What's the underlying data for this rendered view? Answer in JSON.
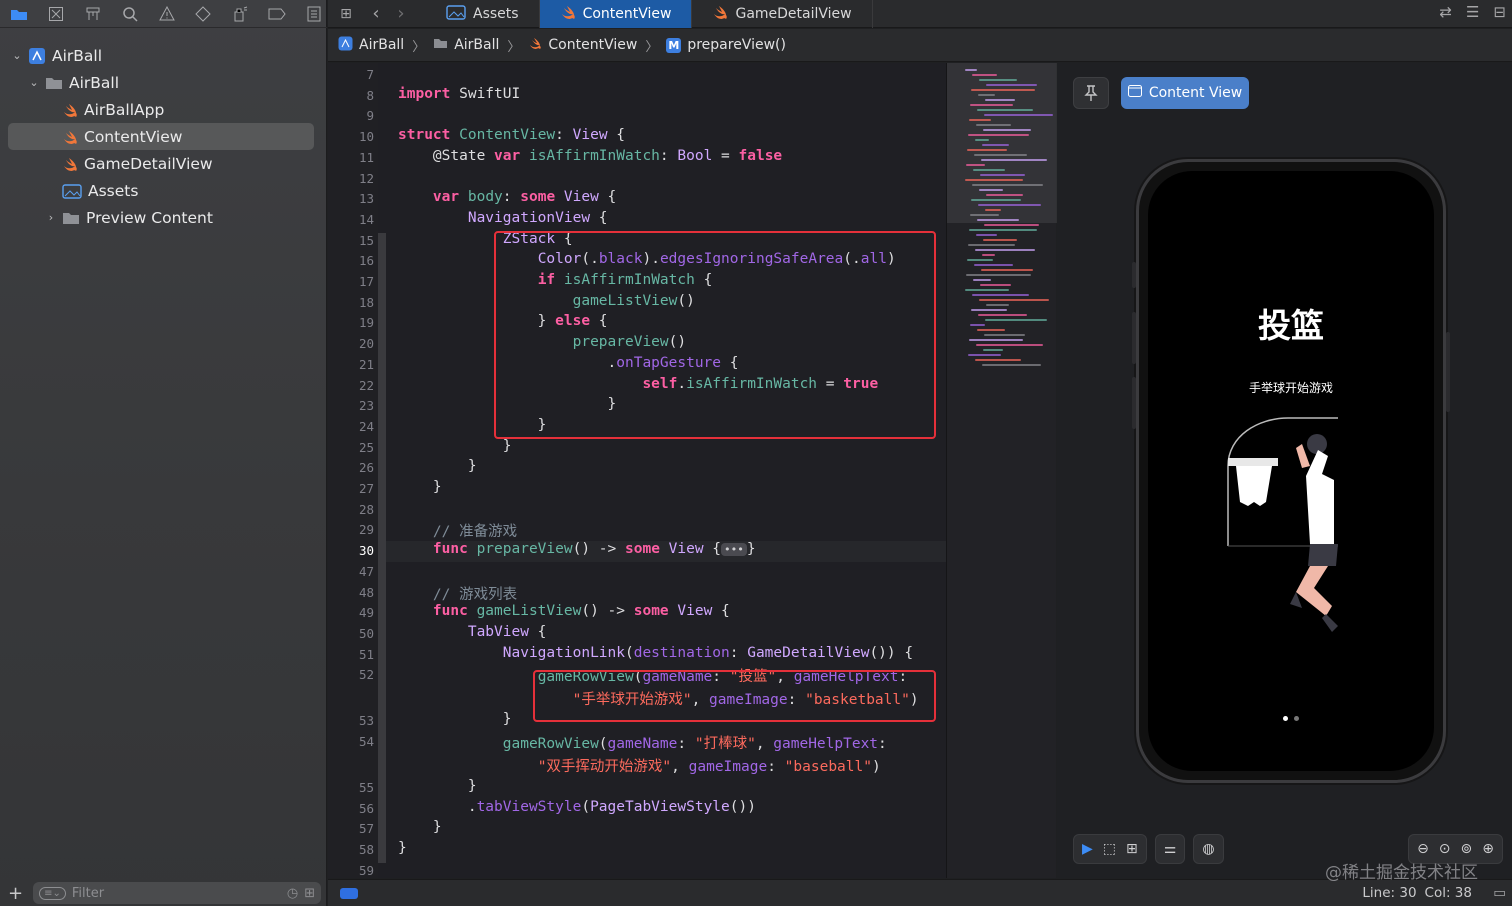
{
  "navigator": {
    "icons": [
      "folder-icon",
      "source-control-icon",
      "hierarchy-icon",
      "find-icon",
      "issue-warning-icon",
      "test-diamond-icon",
      "debug-spray-icon",
      "breakpoint-tag-icon",
      "report-icon"
    ],
    "tree": [
      {
        "label": "AirBall",
        "kind": "project",
        "indent": 0,
        "chevron": "down"
      },
      {
        "label": "AirBall",
        "kind": "folder",
        "indent": 1,
        "chevron": "down"
      },
      {
        "label": "AirBallApp",
        "kind": "swift",
        "indent": 2
      },
      {
        "label": "ContentView",
        "kind": "swift",
        "indent": 2,
        "selected": true
      },
      {
        "label": "GameDetailView",
        "kind": "swift",
        "indent": 2
      },
      {
        "label": "Assets",
        "kind": "assets",
        "indent": 2
      },
      {
        "label": "Preview Content",
        "kind": "folder",
        "indent": 2,
        "chevron": "right"
      }
    ],
    "filter_placeholder": "Filter"
  },
  "tabs": [
    {
      "label": "Assets",
      "active": false
    },
    {
      "label": "ContentView",
      "active": true
    },
    {
      "label": "GameDetailView",
      "active": false
    }
  ],
  "jumpbar": [
    "AirBall",
    "AirBall",
    "ContentView",
    "prepareView()"
  ],
  "jump_method_badge": "M",
  "code": {
    "lines": [
      {
        "n": "7",
        "t": []
      },
      {
        "n": "8",
        "t": [
          [
            "kw",
            "import"
          ],
          [
            "nm",
            " SwiftUI"
          ]
        ]
      },
      {
        "n": "9",
        "t": []
      },
      {
        "n": "10",
        "t": [
          [
            "kw",
            "struct"
          ],
          [
            "nm",
            " "
          ],
          [
            "fn",
            "ContentView"
          ],
          [
            "nm",
            ": "
          ],
          [
            "ty",
            "View"
          ],
          [
            "nm",
            " {"
          ]
        ]
      },
      {
        "n": "11",
        "t": [
          [
            "nm",
            "    @State "
          ],
          [
            "kw",
            "var"
          ],
          [
            "nm",
            " "
          ],
          [
            "fn",
            "isAffirmInWatch"
          ],
          [
            "nm",
            ": "
          ],
          [
            "ty",
            "Bool"
          ],
          [
            "nm",
            " = "
          ],
          [
            "kw",
            "false"
          ]
        ]
      },
      {
        "n": "12",
        "t": []
      },
      {
        "n": "13",
        "t": [
          [
            "nm",
            "    "
          ],
          [
            "kw",
            "var"
          ],
          [
            "nm",
            " "
          ],
          [
            "fn",
            "body"
          ],
          [
            "nm",
            ": "
          ],
          [
            "kw",
            "some"
          ],
          [
            "nm",
            " "
          ],
          [
            "ty",
            "View"
          ],
          [
            "nm",
            " {"
          ]
        ]
      },
      {
        "n": "14",
        "t": [
          [
            "nm",
            "        "
          ],
          [
            "ty",
            "NavigationView"
          ],
          [
            "nm",
            " {"
          ]
        ]
      },
      {
        "n": "15",
        "t": [
          [
            "nm",
            "            "
          ],
          [
            "ty",
            "ZStack"
          ],
          [
            "nm",
            " {"
          ]
        ]
      },
      {
        "n": "16",
        "t": [
          [
            "nm",
            "                "
          ],
          [
            "ty",
            "Color"
          ],
          [
            "nm",
            "(."
          ],
          [
            "pl",
            "black"
          ],
          [
            "nm",
            ")."
          ],
          [
            "pl",
            "edgesIgnoringSafeArea"
          ],
          [
            "nm",
            "(."
          ],
          [
            "pl",
            "all"
          ],
          [
            "nm",
            ")"
          ]
        ]
      },
      {
        "n": "17",
        "t": [
          [
            "nm",
            "                "
          ],
          [
            "kw",
            "if"
          ],
          [
            "nm",
            " "
          ],
          [
            "fn",
            "isAffirmInWatch"
          ],
          [
            "nm",
            " {"
          ]
        ]
      },
      {
        "n": "18",
        "t": [
          [
            "nm",
            "                    "
          ],
          [
            "fn",
            "gameListView"
          ],
          [
            "nm",
            "()"
          ]
        ]
      },
      {
        "n": "19",
        "t": [
          [
            "nm",
            "                } "
          ],
          [
            "kw",
            "else"
          ],
          [
            "nm",
            " {"
          ]
        ]
      },
      {
        "n": "20",
        "t": [
          [
            "nm",
            "                    "
          ],
          [
            "fn",
            "prepareView"
          ],
          [
            "nm",
            "()"
          ]
        ]
      },
      {
        "n": "21",
        "t": [
          [
            "nm",
            "                        ."
          ],
          [
            "pl",
            "onTapGesture"
          ],
          [
            "nm",
            " {"
          ]
        ]
      },
      {
        "n": "22",
        "t": [
          [
            "nm",
            "                            "
          ],
          [
            "kw",
            "self"
          ],
          [
            "nm",
            "."
          ],
          [
            "fn",
            "isAffirmInWatch"
          ],
          [
            "nm",
            " = "
          ],
          [
            "kw",
            "true"
          ]
        ]
      },
      {
        "n": "23",
        "t": [
          [
            "nm",
            "                        }"
          ]
        ]
      },
      {
        "n": "24",
        "t": [
          [
            "nm",
            "                }"
          ]
        ]
      },
      {
        "n": "25",
        "t": [
          [
            "nm",
            "            }"
          ]
        ]
      },
      {
        "n": "26",
        "t": [
          [
            "nm",
            "        }"
          ]
        ]
      },
      {
        "n": "27",
        "t": [
          [
            "nm",
            "    }"
          ]
        ]
      },
      {
        "n": "28",
        "t": []
      },
      {
        "n": "29",
        "t": [
          [
            "cm",
            "    // 准备游戏"
          ]
        ]
      },
      {
        "n": "30",
        "t": [
          [
            "nm",
            "    "
          ],
          [
            "kw",
            "func"
          ],
          [
            "nm",
            " "
          ],
          [
            "fn",
            "prepareView"
          ],
          [
            "nm",
            "() -> "
          ],
          [
            "kw",
            "some"
          ],
          [
            "nm",
            " "
          ],
          [
            "ty",
            "View"
          ],
          [
            "nm",
            " {"
          ],
          [
            "fold",
            "•••"
          ],
          [
            "nm",
            "}"
          ]
        ],
        "current": true
      },
      {
        "n": "47",
        "t": []
      },
      {
        "n": "48",
        "t": [
          [
            "cm",
            "    // 游戏列表"
          ]
        ]
      },
      {
        "n": "49",
        "t": [
          [
            "nm",
            "    "
          ],
          [
            "kw",
            "func"
          ],
          [
            "nm",
            " "
          ],
          [
            "fn",
            "gameListView"
          ],
          [
            "nm",
            "() -> "
          ],
          [
            "kw",
            "some"
          ],
          [
            "nm",
            " "
          ],
          [
            "ty",
            "View"
          ],
          [
            "nm",
            " {"
          ]
        ]
      },
      {
        "n": "50",
        "t": [
          [
            "nm",
            "        "
          ],
          [
            "ty",
            "TabView"
          ],
          [
            "nm",
            " {"
          ]
        ]
      },
      {
        "n": "51",
        "t": [
          [
            "nm",
            "            "
          ],
          [
            "ty",
            "NavigationLink"
          ],
          [
            "nm",
            "("
          ],
          [
            "pl",
            "destination"
          ],
          [
            "nm",
            ": "
          ],
          [
            "ty",
            "GameDetailView"
          ],
          [
            "nm",
            "()) {"
          ]
        ]
      },
      {
        "n": "52",
        "t": [
          [
            "nm",
            "                "
          ],
          [
            "fn",
            "gameRowView"
          ],
          [
            "nm",
            "("
          ],
          [
            "pl",
            "gameName"
          ],
          [
            "nm",
            ": "
          ],
          [
            "st",
            "\"投篮\""
          ],
          [
            "nm",
            ", "
          ],
          [
            "pl",
            "gameHelpText"
          ],
          [
            "nm",
            ":"
          ]
        ]
      },
      {
        "n": "",
        "t": [
          [
            "nm",
            "                    "
          ],
          [
            "st",
            "\"手举球开始游戏\""
          ],
          [
            "nm",
            ", "
          ],
          [
            "pl",
            "gameImage"
          ],
          [
            "nm",
            ": "
          ],
          [
            "st",
            "\"basketball\""
          ],
          [
            "nm",
            ")"
          ]
        ]
      },
      {
        "n": "53",
        "t": [
          [
            "nm",
            "            }"
          ]
        ]
      },
      {
        "n": "54",
        "t": [
          [
            "nm",
            "            "
          ],
          [
            "fn",
            "gameRowView"
          ],
          [
            "nm",
            "("
          ],
          [
            "pl",
            "gameName"
          ],
          [
            "nm",
            ": "
          ],
          [
            "st",
            "\"打棒球\""
          ],
          [
            "nm",
            ", "
          ],
          [
            "pl",
            "gameHelpText"
          ],
          [
            "nm",
            ":"
          ]
        ]
      },
      {
        "n": "",
        "t": [
          [
            "nm",
            "                "
          ],
          [
            "st",
            "\"双手挥动开始游戏\""
          ],
          [
            "nm",
            ", "
          ],
          [
            "pl",
            "gameImage"
          ],
          [
            "nm",
            ": "
          ],
          [
            "st",
            "\"baseball\""
          ],
          [
            "nm",
            ")"
          ]
        ]
      },
      {
        "n": "55",
        "t": [
          [
            "nm",
            "        }"
          ]
        ]
      },
      {
        "n": "56",
        "t": [
          [
            "nm",
            "        ."
          ],
          [
            "pl",
            "tabViewStyle"
          ],
          [
            "nm",
            "("
          ],
          [
            "ty",
            "PageTabViewStyle"
          ],
          [
            "nm",
            "())"
          ]
        ]
      },
      {
        "n": "57",
        "t": [
          [
            "nm",
            "    }"
          ]
        ]
      },
      {
        "n": "58",
        "t": [
          [
            "nm",
            "}"
          ]
        ]
      },
      {
        "n": "59",
        "t": []
      }
    ]
  },
  "preview": {
    "content_view_label": "Content View",
    "title": "投篮",
    "subtitle": "手举球开始游戏"
  },
  "status": {
    "line_label": "Line: 30",
    "col_label": "Col: 38"
  },
  "watermark": "@稀土掘金技术社区",
  "colors": {
    "keyword": "#fc5fa3",
    "type": "#d0a8ff",
    "func": "#67b7a4",
    "param": "#a167e6",
    "string": "#fc6a5d",
    "comment": "#7f8c98",
    "accent": "#1d5ba5",
    "highlight_box": "#e5303a"
  }
}
